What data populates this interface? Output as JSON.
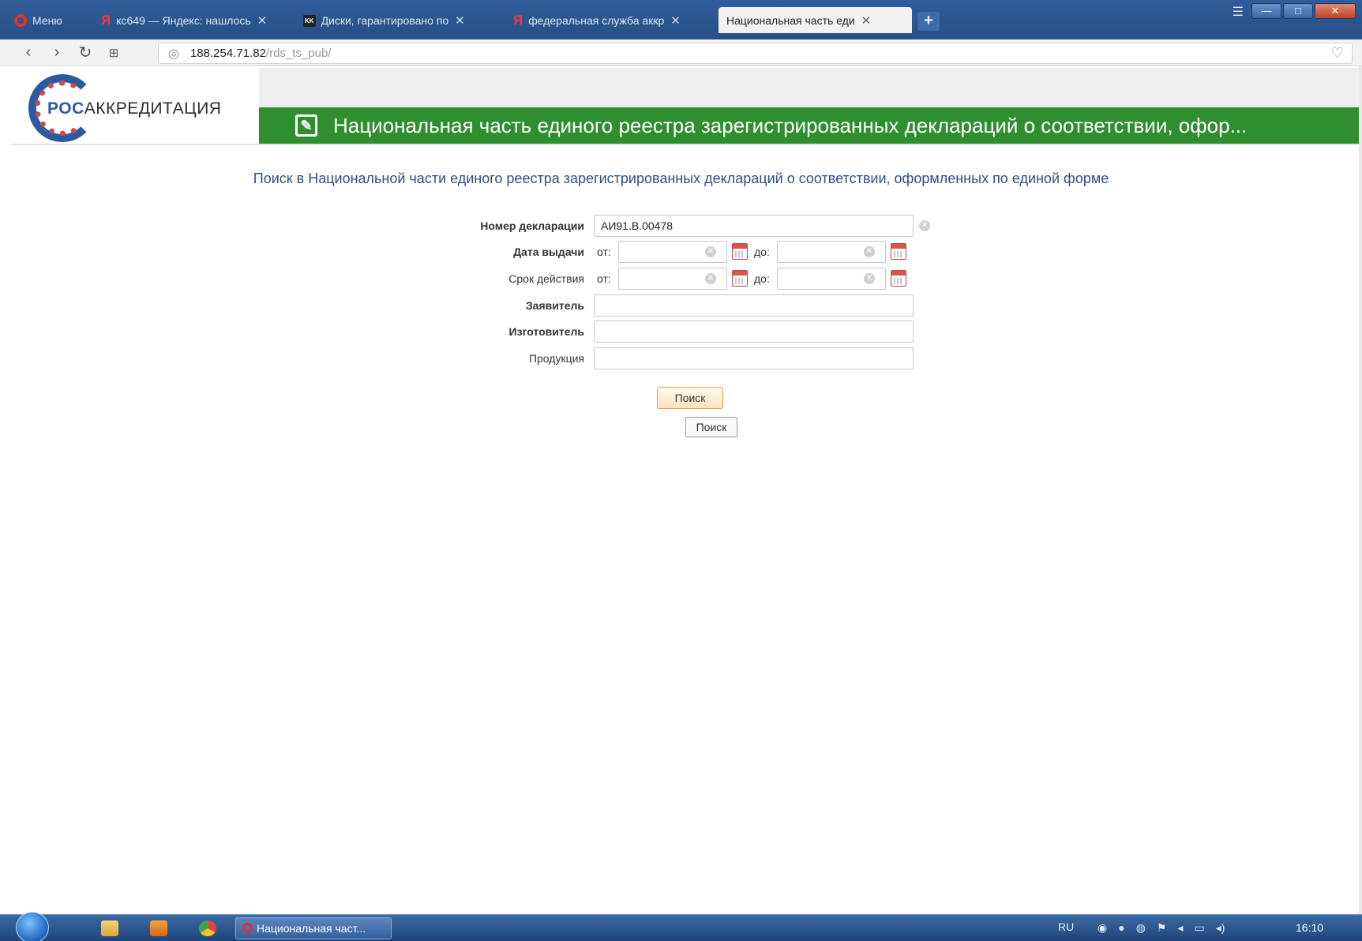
{
  "browser": {
    "menu_label": "Меню",
    "tabs": [
      {
        "label": "кс649 — Яндекс: нашлось"
      },
      {
        "label": "Диски, гарантировано по"
      },
      {
        "label": "федеральная служба аккр"
      },
      {
        "label": "Национальная часть еди"
      }
    ],
    "address": {
      "host": "188.254.71.82",
      "path": "/rds_ts_pub/"
    }
  },
  "header": {
    "logo_prefix": "РОС",
    "logo_rest": "АККРЕДИТАЦИЯ",
    "title": "Национальная часть единого реестра зарегистрированных деклараций о соответствии, офор..."
  },
  "search": {
    "heading": "Поиск в Национальной части единого реестра зарегистрированных деклараций о соответствии, оформленных по единой форме",
    "fields": {
      "declaration_number": {
        "label": "Номер декларации",
        "value": "АИ91.В.00478"
      },
      "issue_date": {
        "label": "Дата выдачи",
        "from": "от:",
        "to": "до:"
      },
      "validity": {
        "label": "Срок действия",
        "from": "от:",
        "to": "до:"
      },
      "applicant": {
        "label": "Заявитель",
        "value": ""
      },
      "manufacturer": {
        "label": "Изготовитель",
        "value": ""
      },
      "products": {
        "label": "Продукция",
        "value": ""
      }
    },
    "button_primary": "Поиск",
    "button_secondary": "Поиск"
  },
  "taskbar": {
    "task_label": "Национальная част...",
    "lang": "RU",
    "clock": "16:10"
  },
  "colors": {
    "header_green": "#2f8f2f",
    "heading_blue": "#2b4f8c",
    "taskbar_blue": "#2a5792"
  }
}
